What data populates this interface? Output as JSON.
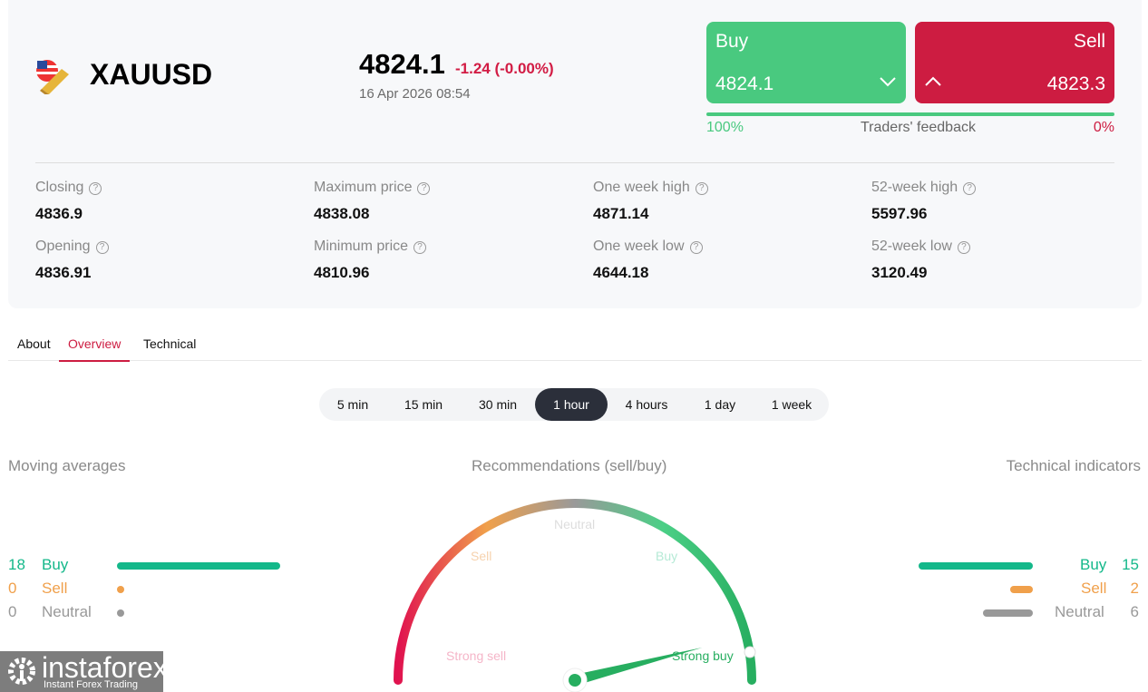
{
  "instrument": {
    "symbol": "XAUUSD",
    "price": "4824.1",
    "change": "-1.24 (-0.00%)",
    "datetime": "16 Apr 2026 08:54"
  },
  "trade": {
    "buy_label": "Buy",
    "buy_price": "4824.1",
    "sell_label": "Sell",
    "sell_price": "4823.3",
    "feedback_label": "Traders' feedback",
    "buy_pct": "100%",
    "sell_pct": "0%",
    "buy_fraction": 1.0
  },
  "stats": [
    {
      "label": "Closing",
      "value": "4836.9"
    },
    {
      "label": "Maximum price",
      "value": "4838.08"
    },
    {
      "label": "One week high",
      "value": "4871.14"
    },
    {
      "label": "52-week high",
      "value": "5597.96"
    },
    {
      "label": "Opening",
      "value": "4836.91"
    },
    {
      "label": "Minimum price",
      "value": "4810.96"
    },
    {
      "label": "One week low",
      "value": "4644.18"
    },
    {
      "label": "52-week low",
      "value": "3120.49"
    }
  ],
  "tabs": [
    "About",
    "Overview",
    "Technical"
  ],
  "active_tab": "Overview",
  "periods": [
    "5 min",
    "15 min",
    "30 min",
    "1 hour",
    "4 hours",
    "1 day",
    "1 week"
  ],
  "active_period": "1 hour",
  "moving_averages": {
    "title": "Moving averages",
    "rows": [
      {
        "count": "18",
        "label": "Buy"
      },
      {
        "count": "0",
        "label": "Sell"
      },
      {
        "count": "0",
        "label": "Neutral"
      }
    ]
  },
  "recommendations": {
    "title": "Recommendations (sell/buy)",
    "labels": {
      "strong_sell": "Strong sell",
      "sell": "Sell",
      "neutral": "Neutral",
      "buy": "Buy",
      "strong_buy": "Strong buy"
    },
    "needle_value": 0.92
  },
  "technical_indicators": {
    "title": "Technical indicators",
    "rows": [
      {
        "count": "15",
        "label": "Buy"
      },
      {
        "count": "2",
        "label": "Sell"
      },
      {
        "count": "6",
        "label": "Neutral"
      }
    ]
  },
  "colors": {
    "buy": "#49c97f",
    "sell": "#cd1c41",
    "ma_buy": "#14b88a",
    "ma_sell": "#f0a04b",
    "neutral": "#999999"
  },
  "logo": {
    "name": "instaforex",
    "tagline": "Instant Forex Trading"
  }
}
